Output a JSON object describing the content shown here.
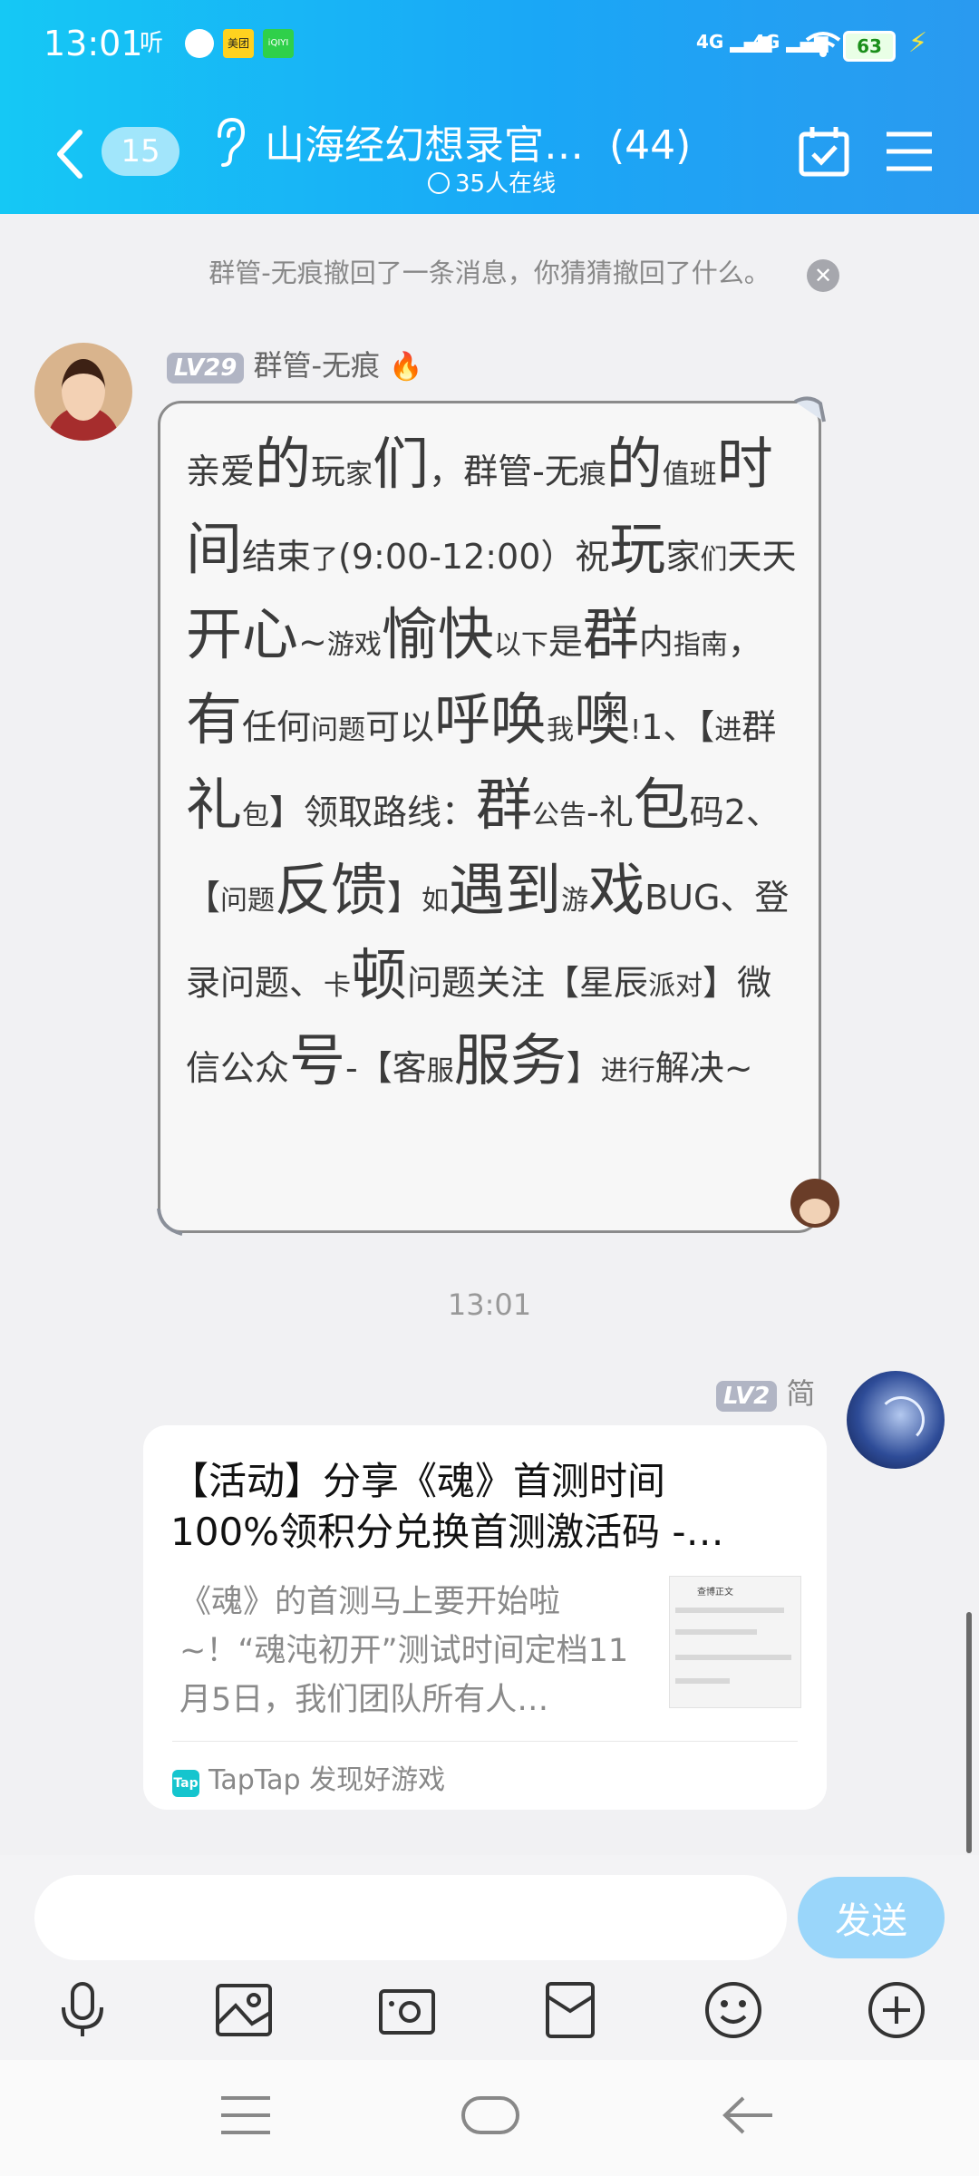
{
  "status_bar": {
    "time": "13:01",
    "listen_icon_text": "听",
    "app_icons": [
      "美团",
      "iQIYI"
    ],
    "network": [
      "4G",
      "4G"
    ],
    "battery": "63"
  },
  "header": {
    "back_count": "15",
    "title": "山海经幻想录官…",
    "member_count": "(44)",
    "online": "35人在线"
  },
  "system_notice": "群管-无痕撤回了一条消息，你猜猜撤回了什么。",
  "admin_message": {
    "level": "LV29",
    "sender": "群管-无痕",
    "segments": [
      {
        "t": "亲爱",
        "c": "s"
      },
      {
        "t": "的",
        "c": "l"
      },
      {
        "t": "玩",
        "c": "s"
      },
      {
        "t": "家",
        "c": "xs"
      },
      {
        "t": "们",
        "c": "l"
      },
      {
        "t": "，群管-无",
        "c": "s"
      },
      {
        "t": "痕",
        "c": "xs"
      },
      {
        "t": "的",
        "c": "l"
      },
      {
        "t": "值",
        "c": "xs"
      },
      {
        "t": "班",
        "c": "xs"
      },
      {
        "t": "时间",
        "c": "l"
      },
      {
        "t": "结束",
        "c": "s"
      },
      {
        "t": "了",
        "c": "xs"
      },
      {
        "t": "(9:00-12:00）祝",
        "c": "s"
      },
      {
        "t": "玩",
        "c": "l"
      },
      {
        "t": "家",
        "c": "s"
      },
      {
        "t": "们",
        "c": "xs"
      },
      {
        "t": "天天",
        "c": "s"
      },
      {
        "t": "开心",
        "c": "l"
      },
      {
        "t": "~",
        "c": "s"
      },
      {
        "t": "游戏",
        "c": "xs"
      },
      {
        "t": "愉快",
        "c": "l"
      },
      {
        "t": "以下",
        "c": "xs"
      },
      {
        "t": "是",
        "c": "s"
      },
      {
        "t": "群",
        "c": "l"
      },
      {
        "t": "内",
        "c": "s"
      },
      {
        "t": "指南",
        "c": "xs"
      },
      {
        "t": "，",
        "c": "s"
      },
      {
        "t": "有",
        "c": "l"
      },
      {
        "t": "任何",
        "c": "s"
      },
      {
        "t": "问题",
        "c": "xs"
      },
      {
        "t": "可以",
        "c": "s"
      },
      {
        "t": "呼唤",
        "c": "l"
      },
      {
        "t": "我",
        "c": "xs"
      },
      {
        "t": "噢",
        "c": "l"
      },
      {
        "t": "!",
        "c": "xs"
      },
      {
        "t": "1、【",
        "c": "s"
      },
      {
        "t": "进",
        "c": "xs"
      },
      {
        "t": "群",
        "c": "s"
      },
      {
        "t": "礼",
        "c": "l"
      },
      {
        "t": "包",
        "c": "xs"
      },
      {
        "t": "】领取路线：",
        "c": "s"
      },
      {
        "t": "群",
        "c": "l"
      },
      {
        "t": "公告",
        "c": "xs"
      },
      {
        "t": "-礼",
        "c": "s"
      },
      {
        "t": "包",
        "c": "l"
      },
      {
        "t": "码",
        "c": "s"
      },
      {
        "t": "2、【",
        "c": "s"
      },
      {
        "t": "问题",
        "c": "xs"
      },
      {
        "t": "反馈",
        "c": "l"
      },
      {
        "t": "】",
        "c": "s"
      },
      {
        "t": "如",
        "c": "xs"
      },
      {
        "t": "遇到",
        "c": "l"
      },
      {
        "t": "游",
        "c": "xs"
      },
      {
        "t": "戏",
        "c": "l"
      },
      {
        "t": "BUG、登录问题、",
        "c": "s"
      },
      {
        "t": "卡",
        "c": "xs"
      },
      {
        "t": "顿",
        "c": "l"
      },
      {
        "t": "问题",
        "c": "s"
      },
      {
        "t": "关注【星辰",
        "c": "s"
      },
      {
        "t": "派对",
        "c": "xs"
      },
      {
        "t": "】微信公众",
        "c": "s"
      },
      {
        "t": "号",
        "c": "l"
      },
      {
        "t": "-【客",
        "c": "s"
      },
      {
        "t": "服",
        "c": "xs"
      },
      {
        "t": "服务",
        "c": "l"
      },
      {
        "t": "】",
        "c": "s"
      },
      {
        "t": "进行",
        "c": "xs"
      },
      {
        "t": "解决~",
        "c": "s"
      }
    ]
  },
  "timestamp": "13:01",
  "my_message": {
    "level": "LV2",
    "sender": "简",
    "card": {
      "title_line1": "【活动】分享《魂》首测时间",
      "title_line2": "100%领积分兑换首测激活码 -…",
      "desc": "《魂》的首测马上要开始啦~！“魂沌初开”测试时间定档11月5日，我们团队所有人…",
      "thumb_caption": "查博正文",
      "source_logo": "Tap",
      "source": "TapTap 发现好游戏"
    }
  },
  "input": {
    "placeholder": "",
    "send_label": "发送"
  },
  "toolbar": [
    "mic-icon",
    "image-icon",
    "camera-icon",
    "red-packet-icon",
    "emoji-icon",
    "plus-icon"
  ]
}
